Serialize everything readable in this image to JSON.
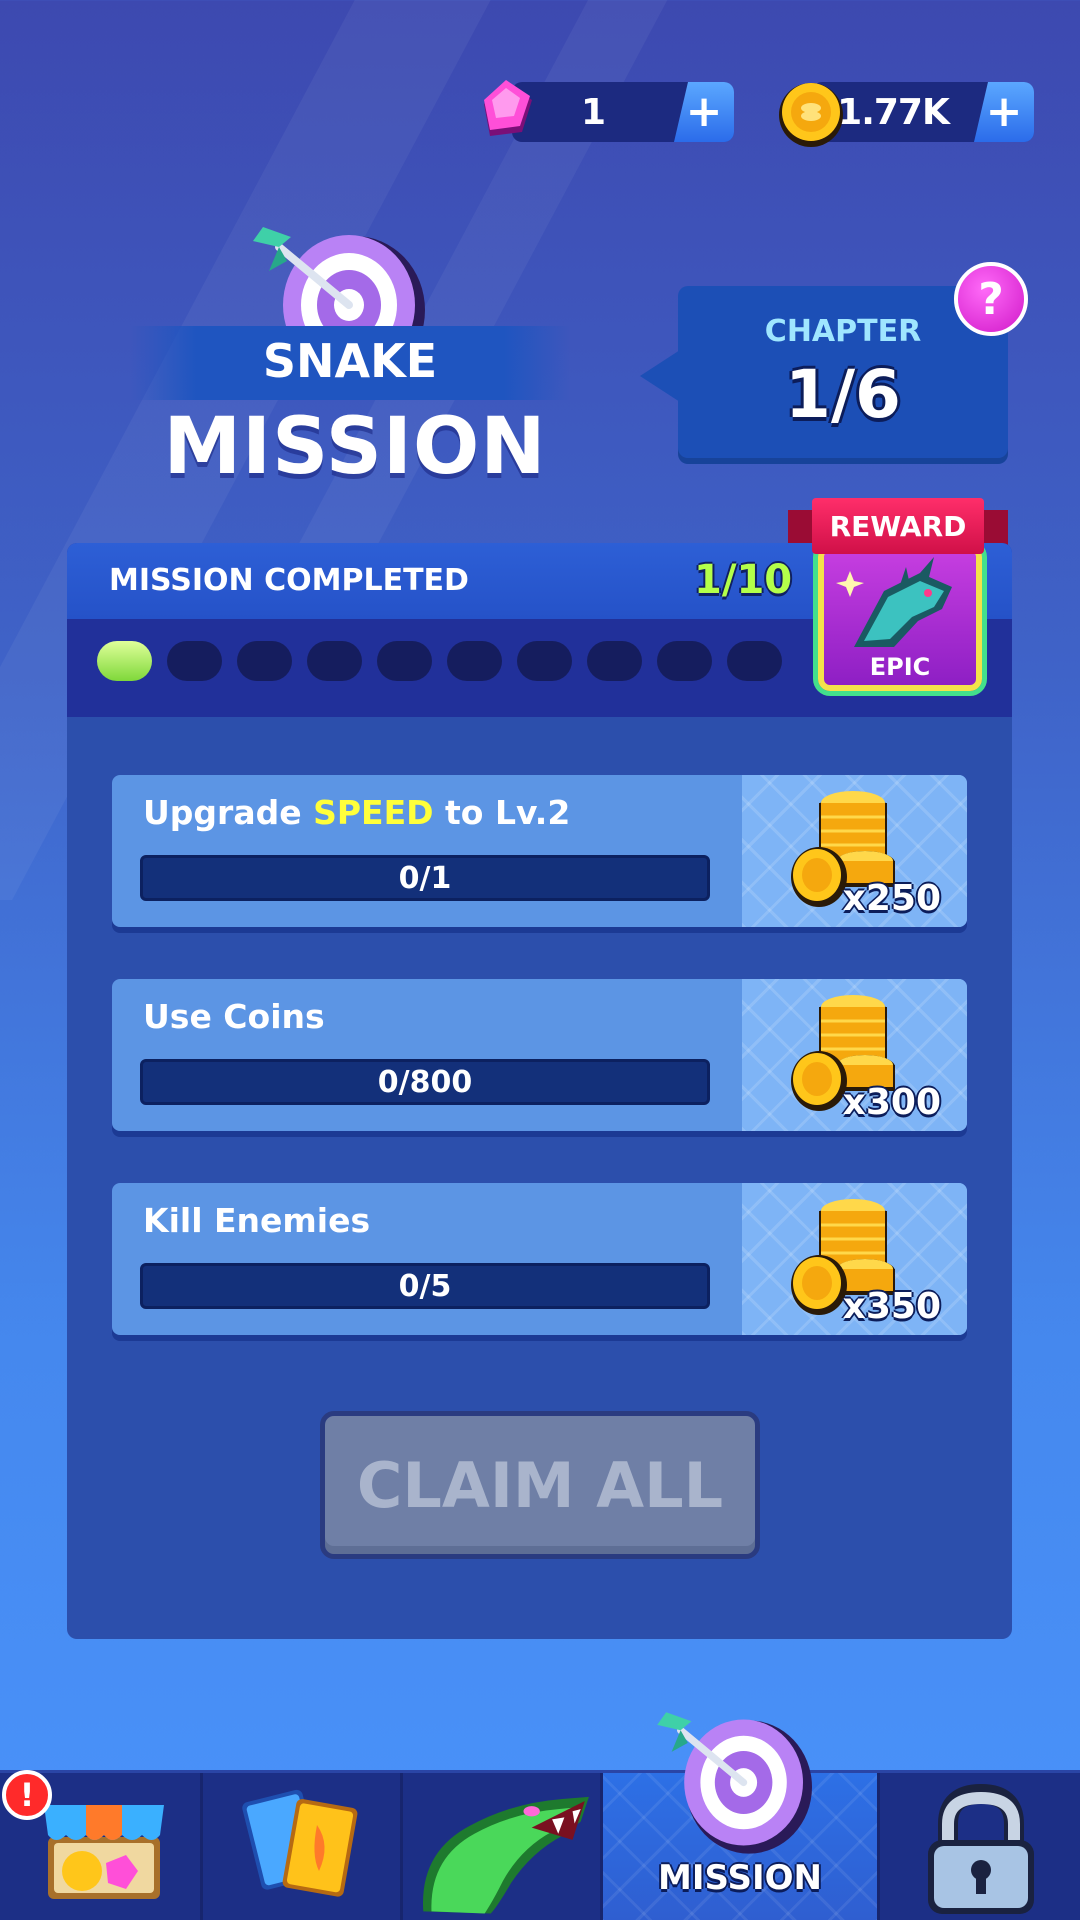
{
  "currency": {
    "gems": "1",
    "coins": "1.77K",
    "plus": "+"
  },
  "title": {
    "line1": "SNAKE",
    "line2": "MISSION"
  },
  "chapter": {
    "label": "CHAPTER",
    "value": "1/6",
    "help": "?"
  },
  "progress": {
    "label": "MISSION COMPLETED",
    "count": "1/10",
    "completed": 1,
    "total": 10
  },
  "reward": {
    "tag": "REWARD",
    "rarity": "EPIC"
  },
  "missions": [
    {
      "text_before": "Upgrade ",
      "highlight": "SPEED",
      "text_after": " to Lv.2",
      "progress": "0/1",
      "reward": "x250"
    },
    {
      "text_before": "Use Coins",
      "highlight": "",
      "text_after": "",
      "progress": "0/800",
      "reward": "x300"
    },
    {
      "text_before": "Kill Enemies",
      "highlight": "",
      "text_after": "",
      "progress": "0/5",
      "reward": "x350"
    }
  ],
  "claim_all": "CLAIM ALL",
  "nav": {
    "active_label": "MISSION",
    "alert": "!",
    "tabs": [
      "shop-icon",
      "cards-icon",
      "snake-icon",
      "target-icon",
      "lock-icon"
    ]
  },
  "colors": {
    "highlight": "#ffff3a",
    "progress_on": "#b4ff4a",
    "reward_tag": "#ff2e6a",
    "epic_card": "#c63ee0"
  }
}
